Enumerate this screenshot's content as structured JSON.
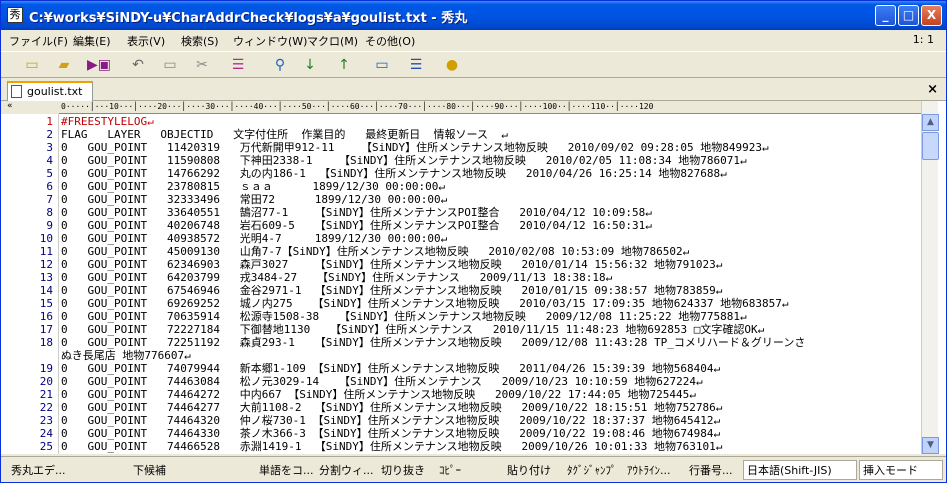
{
  "window": {
    "title": "C:¥works¥SiNDY-u¥CharAddrCheck¥logs¥a¥goulist.txt  - 秀丸",
    "app_icon": "hidemaru-app-icon",
    "min": "_",
    "max": "□",
    "close": "X"
  },
  "menu": {
    "items": [
      "ファイル(F)",
      "編集(E)",
      "表示(V)",
      "検索(S)",
      "ウィンドウ(W)",
      "マクロ(M)",
      "その他(O)"
    ],
    "zoom": "1: 1"
  },
  "toolbar": {
    "icons": [
      "new-icon",
      "open-icon",
      "save-icon",
      "undo-icon",
      "copy-icon",
      "cut-icon",
      "paste-icon",
      "search-icon",
      "search-down-icon",
      "search-up-icon",
      "grep-icon",
      "split-icon",
      "help-icon"
    ]
  },
  "tab": {
    "label": "goulist.txt",
    "close": "×"
  },
  "ruler": {
    "text": "0·····│···10···│····20···│····30···│····40···│····50···│····60···│····70···│····80···│····90···│····100··│····110··│····120"
  },
  "gutter_top": "«",
  "lines": [
    {
      "n": "1",
      "t": "#FREESTYLELOG↵"
    },
    {
      "n": "2",
      "t": "FLAG   LAYER   OBJECTID   文字付住所  作業目的   最終更新日  情報ソース  ↵"
    },
    {
      "n": "3",
      "t": "0   GOU_POINT   11420319   万代新開甲912-11    【SiNDY】住所メンテナンス地物反映   2010/09/02 09:28:05 地物849923↵"
    },
    {
      "n": "4",
      "t": "0   GOU_POINT   11590808   下神田2338-1    【SiNDY】住所メンテナンス地物反映   2010/02/05 11:08:34 地物786071↵"
    },
    {
      "n": "5",
      "t": "0   GOU_POINT   14766292   丸の内186-1  【SiNDY】住所メンテナンス地物反映   2010/04/26 16:25:14 地物827688↵"
    },
    {
      "n": "6",
      "t": "0   GOU_POINT   23780815   ｓａａ      1899/12/30 00:00:00↵"
    },
    {
      "n": "7",
      "t": "0   GOU_POINT   32333496   常田72      1899/12/30 00:00:00↵"
    },
    {
      "n": "8",
      "t": "0   GOU_POINT   33640551   鵠沼77-1    【SiNDY】住所メンテナンスPOI整合   2010/04/12 10:09:58↵"
    },
    {
      "n": "9",
      "t": "0   GOU_POINT   40206748   岩石609-5   【SiNDY】住所メンテナンスPOI整合   2010/04/12 16:50:31↵"
    },
    {
      "n": "10",
      "t": "0   GOU_POINT   40938572   光明4-7     1899/12/30 00:00:00↵"
    },
    {
      "n": "11",
      "t": "0   GOU_POINT   45009130   山角7-7【SiNDY】住所メンテナンス地物反映   2010/02/08 10:53:09 地物786502↵"
    },
    {
      "n": "12",
      "t": "0   GOU_POINT   62346903   森戸3027    【SiNDY】住所メンテナンス地物反映   2010/01/14 15:56:32 地物791023↵"
    },
    {
      "n": "13",
      "t": "0   GOU_POINT   64203799   戎3484-27   【SiNDY】住所メンテナンス   2009/11/13 18:38:18↵"
    },
    {
      "n": "14",
      "t": "0   GOU_POINT   67546946   金谷2971-1  【SiNDY】住所メンテナンス地物反映   2010/01/15 09:38:57 地物783859↵"
    },
    {
      "n": "15",
      "t": "0   GOU_POINT   69269252   城ノ内275   【SiNDY】住所メンテナンス地物反映   2010/03/15 17:09:35 地物624337 地物683857↵"
    },
    {
      "n": "16",
      "t": "0   GOU_POINT   70635914   松源寺1508-38   【SiNDY】住所メンテナンス地物反映   2009/12/08 11:25:22 地物775881↵"
    },
    {
      "n": "17",
      "t": "0   GOU_POINT   72227184   下御替地1130   【SiNDY】住所メンテナンス   2010/11/15 11:48:23 地物692853 □文字確認OK↵"
    },
    {
      "n": "18",
      "t": "0   GOU_POINT   72251192   森貞293-1   【SiNDY】住所メンテナンス地物反映   2009/12/08 11:43:28 TP_コメリハード＆グリーンさ"
    },
    {
      "n": "",
      "t": "ぬき長尾店 地物776607↵"
    },
    {
      "n": "19",
      "t": "0   GOU_POINT   74079944   新本郷1-109 【SiNDY】住所メンテナンス地物反映   2011/04/26 15:39:39 地物568404↵"
    },
    {
      "n": "20",
      "t": "0   GOU_POINT   74463084   松ノ元3029-14   【SiNDY】住所メンテナンス   2009/10/23 10:10:59 地物627224↵"
    },
    {
      "n": "21",
      "t": "0   GOU_POINT   74464272   中内667 【SiNDY】住所メンテナンス地物反映   2009/10/22 17:44:05 地物725445↵"
    },
    {
      "n": "22",
      "t": "0   GOU_POINT   74464277   大前1108-2  【SiNDY】住所メンテナンス地物反映   2009/10/22 18:15:51 地物752786↵"
    },
    {
      "n": "23",
      "t": "0   GOU_POINT   74464320   仲ノ桜730-1 【SiNDY】住所メンテナンス地物反映   2009/10/22 18:37:37 地物645412↵"
    },
    {
      "n": "24",
      "t": "0   GOU_POINT   74464330   茶ノ木366-3 【SiNDY】住所メンテナンス地物反映   2009/10/22 19:08:46 地物674984↵"
    },
    {
      "n": "25",
      "t": "0   GOU_POINT   74466528   赤淵1419-1  【SiNDY】住所メンテナンス地物反映   2009/10/26 10:01:33 地物763101↵"
    }
  ],
  "status": {
    "items": [
      "秀丸エデ...",
      "下候補",
      "単語をコ...",
      "分割ウィ...",
      "切り抜き",
      "ｺﾋﾟｰ",
      "貼り付け",
      "ﾀｸﾞｼﾞｬﾝﾌﾟ",
      "ｱｳﾄﾗｲﾝ...",
      "行番号...",
      "日本語(Shift-JIS)",
      "挿入モード"
    ]
  }
}
